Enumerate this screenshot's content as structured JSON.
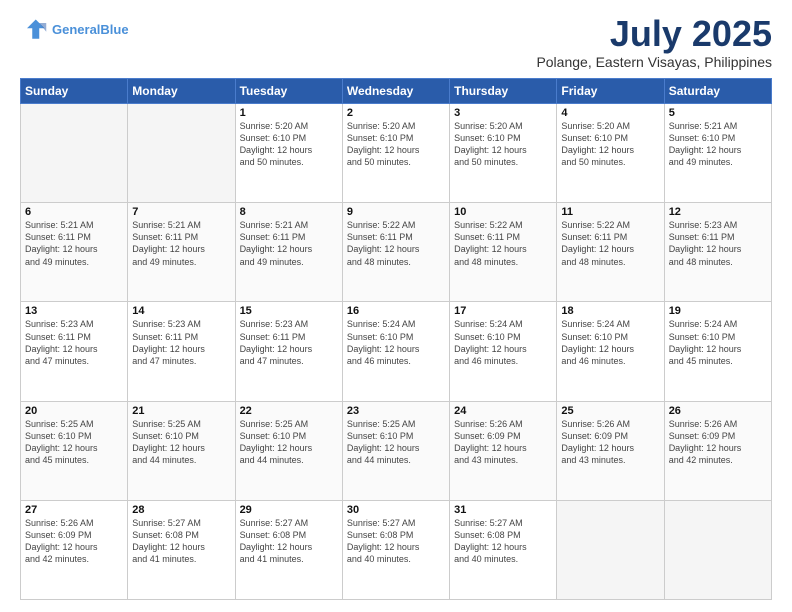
{
  "header": {
    "logo_line1": "General",
    "logo_line2": "Blue",
    "main_title": "July 2025",
    "subtitle": "Polange, Eastern Visayas, Philippines"
  },
  "days_of_week": [
    "Sunday",
    "Monday",
    "Tuesday",
    "Wednesday",
    "Thursday",
    "Friday",
    "Saturday"
  ],
  "weeks": [
    [
      {
        "day": "",
        "info": ""
      },
      {
        "day": "",
        "info": ""
      },
      {
        "day": "1",
        "info": "Sunrise: 5:20 AM\nSunset: 6:10 PM\nDaylight: 12 hours\nand 50 minutes."
      },
      {
        "day": "2",
        "info": "Sunrise: 5:20 AM\nSunset: 6:10 PM\nDaylight: 12 hours\nand 50 minutes."
      },
      {
        "day": "3",
        "info": "Sunrise: 5:20 AM\nSunset: 6:10 PM\nDaylight: 12 hours\nand 50 minutes."
      },
      {
        "day": "4",
        "info": "Sunrise: 5:20 AM\nSunset: 6:10 PM\nDaylight: 12 hours\nand 50 minutes."
      },
      {
        "day": "5",
        "info": "Sunrise: 5:21 AM\nSunset: 6:10 PM\nDaylight: 12 hours\nand 49 minutes."
      }
    ],
    [
      {
        "day": "6",
        "info": "Sunrise: 5:21 AM\nSunset: 6:11 PM\nDaylight: 12 hours\nand 49 minutes."
      },
      {
        "day": "7",
        "info": "Sunrise: 5:21 AM\nSunset: 6:11 PM\nDaylight: 12 hours\nand 49 minutes."
      },
      {
        "day": "8",
        "info": "Sunrise: 5:21 AM\nSunset: 6:11 PM\nDaylight: 12 hours\nand 49 minutes."
      },
      {
        "day": "9",
        "info": "Sunrise: 5:22 AM\nSunset: 6:11 PM\nDaylight: 12 hours\nand 48 minutes."
      },
      {
        "day": "10",
        "info": "Sunrise: 5:22 AM\nSunset: 6:11 PM\nDaylight: 12 hours\nand 48 minutes."
      },
      {
        "day": "11",
        "info": "Sunrise: 5:22 AM\nSunset: 6:11 PM\nDaylight: 12 hours\nand 48 minutes."
      },
      {
        "day": "12",
        "info": "Sunrise: 5:23 AM\nSunset: 6:11 PM\nDaylight: 12 hours\nand 48 minutes."
      }
    ],
    [
      {
        "day": "13",
        "info": "Sunrise: 5:23 AM\nSunset: 6:11 PM\nDaylight: 12 hours\nand 47 minutes."
      },
      {
        "day": "14",
        "info": "Sunrise: 5:23 AM\nSunset: 6:11 PM\nDaylight: 12 hours\nand 47 minutes."
      },
      {
        "day": "15",
        "info": "Sunrise: 5:23 AM\nSunset: 6:11 PM\nDaylight: 12 hours\nand 47 minutes."
      },
      {
        "day": "16",
        "info": "Sunrise: 5:24 AM\nSunset: 6:10 PM\nDaylight: 12 hours\nand 46 minutes."
      },
      {
        "day": "17",
        "info": "Sunrise: 5:24 AM\nSunset: 6:10 PM\nDaylight: 12 hours\nand 46 minutes."
      },
      {
        "day": "18",
        "info": "Sunrise: 5:24 AM\nSunset: 6:10 PM\nDaylight: 12 hours\nand 46 minutes."
      },
      {
        "day": "19",
        "info": "Sunrise: 5:24 AM\nSunset: 6:10 PM\nDaylight: 12 hours\nand 45 minutes."
      }
    ],
    [
      {
        "day": "20",
        "info": "Sunrise: 5:25 AM\nSunset: 6:10 PM\nDaylight: 12 hours\nand 45 minutes."
      },
      {
        "day": "21",
        "info": "Sunrise: 5:25 AM\nSunset: 6:10 PM\nDaylight: 12 hours\nand 44 minutes."
      },
      {
        "day": "22",
        "info": "Sunrise: 5:25 AM\nSunset: 6:10 PM\nDaylight: 12 hours\nand 44 minutes."
      },
      {
        "day": "23",
        "info": "Sunrise: 5:25 AM\nSunset: 6:10 PM\nDaylight: 12 hours\nand 44 minutes."
      },
      {
        "day": "24",
        "info": "Sunrise: 5:26 AM\nSunset: 6:09 PM\nDaylight: 12 hours\nand 43 minutes."
      },
      {
        "day": "25",
        "info": "Sunrise: 5:26 AM\nSunset: 6:09 PM\nDaylight: 12 hours\nand 43 minutes."
      },
      {
        "day": "26",
        "info": "Sunrise: 5:26 AM\nSunset: 6:09 PM\nDaylight: 12 hours\nand 42 minutes."
      }
    ],
    [
      {
        "day": "27",
        "info": "Sunrise: 5:26 AM\nSunset: 6:09 PM\nDaylight: 12 hours\nand 42 minutes."
      },
      {
        "day": "28",
        "info": "Sunrise: 5:27 AM\nSunset: 6:08 PM\nDaylight: 12 hours\nand 41 minutes."
      },
      {
        "day": "29",
        "info": "Sunrise: 5:27 AM\nSunset: 6:08 PM\nDaylight: 12 hours\nand 41 minutes."
      },
      {
        "day": "30",
        "info": "Sunrise: 5:27 AM\nSunset: 6:08 PM\nDaylight: 12 hours\nand 40 minutes."
      },
      {
        "day": "31",
        "info": "Sunrise: 5:27 AM\nSunset: 6:08 PM\nDaylight: 12 hours\nand 40 minutes."
      },
      {
        "day": "",
        "info": ""
      },
      {
        "day": "",
        "info": ""
      }
    ]
  ]
}
